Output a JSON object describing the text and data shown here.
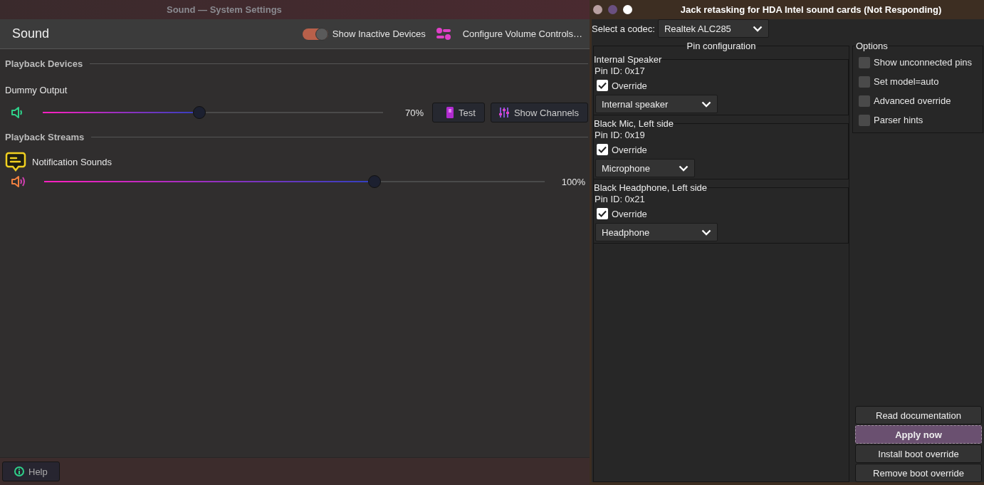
{
  "settings_window": {
    "title": "Sound — System Settings",
    "heading": "Sound",
    "show_inactive": {
      "label": "Show Inactive Devices",
      "on": true
    },
    "configure_label": "Configure Volume Controls…",
    "sections": [
      {
        "title": "Playback Devices",
        "items": [
          {
            "kind": "device",
            "name": "Dummy Output",
            "level": 0.46,
            "reading": "70%",
            "buttons": [
              "Test",
              "Show Channels"
            ]
          }
        ]
      },
      {
        "title": "Playback Streams",
        "items": [
          {
            "kind": "stream",
            "name": "Notification Sounds",
            "level": 0.66,
            "reading": "100%"
          }
        ]
      }
    ],
    "help": "Help"
  },
  "jack_window": {
    "title": "Jack retasking for HDA Intel sound cards (Not Responding)",
    "codec_label": "Select a codec:",
    "codec": "Realtek ALC285",
    "pin_title": "Pin configuration",
    "pins": [
      {
        "name": "Internal Speaker",
        "pin_id": "Pin ID: 0x17",
        "override": "Override",
        "checked": true,
        "value": "Internal speaker"
      },
      {
        "name": "Black Mic, Left side",
        "pin_id": "Pin ID: 0x19",
        "override": "Override",
        "checked": true,
        "value": "Microphone"
      },
      {
        "name": "Black Headphone, Left side",
        "pin_id": "Pin ID: 0x21",
        "override": "Override",
        "checked": true,
        "value": "Headphone"
      }
    ],
    "options_title": "Options",
    "options": [
      {
        "label": "Show unconnected pins",
        "checked": false
      },
      {
        "label": "Set model=auto",
        "checked": false
      },
      {
        "label": "Advanced override",
        "checked": false
      },
      {
        "label": "Parser hints",
        "checked": false
      }
    ],
    "buttons": [
      {
        "label": "Read documentation",
        "selected": false
      },
      {
        "label": "Apply now",
        "selected": true
      },
      {
        "label": "Install boot override",
        "selected": false
      },
      {
        "label": "Remove boot override",
        "selected": false
      }
    ]
  }
}
